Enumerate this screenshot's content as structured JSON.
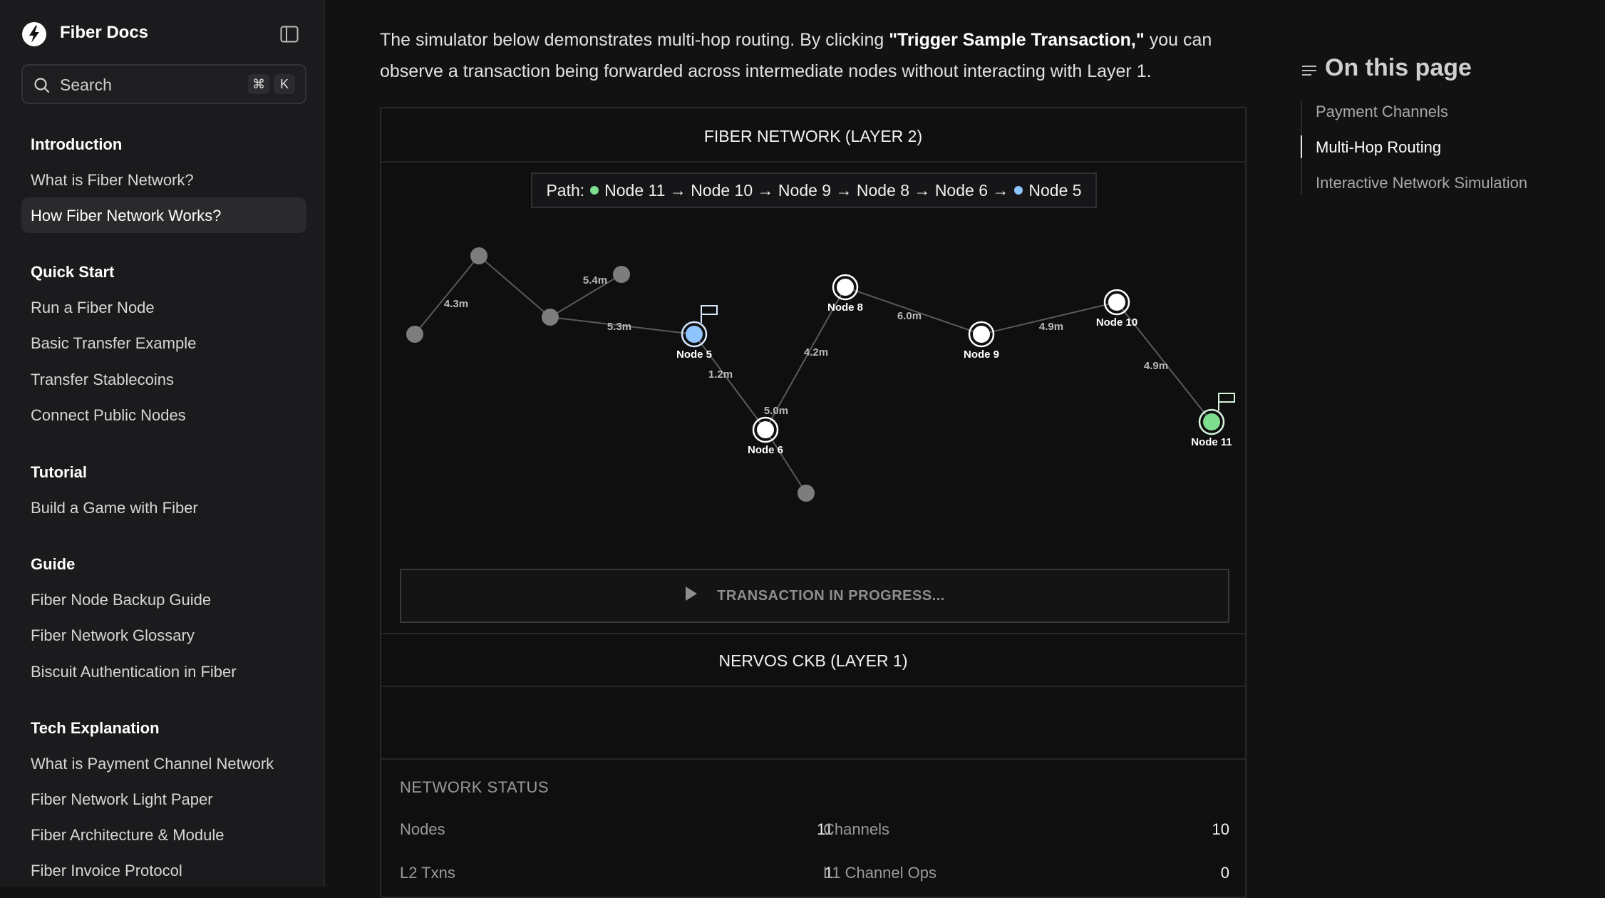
{
  "app": {
    "brand": "Fiber Docs"
  },
  "search": {
    "placeholder": "Search",
    "shortcut_mod": "⌘",
    "shortcut_key": "K"
  },
  "sidebar": {
    "sections": [
      {
        "title": "Introduction",
        "items": [
          "What is Fiber Network?",
          "How Fiber Network Works?"
        ]
      },
      {
        "title": "Quick Start",
        "items": [
          "Run a Fiber Node",
          "Basic Transfer Example",
          "Transfer Stablecoins",
          "Connect Public Nodes"
        ]
      },
      {
        "title": "Tutorial",
        "items": [
          "Build a Game with Fiber"
        ]
      },
      {
        "title": "Guide",
        "items": [
          "Fiber Node Backup Guide",
          "Fiber Network Glossary",
          "Biscuit Authentication in Fiber"
        ]
      },
      {
        "title": "Tech Explanation",
        "items": [
          "What is Payment Channel Network",
          "Fiber Network Light Paper",
          "Fiber Architecture & Module",
          "Fiber Invoice Protocol"
        ]
      }
    ],
    "active_item": "How Fiber Network Works?"
  },
  "main": {
    "intro_pre": "The simulator below demonstrates multi-hop routing. By clicking ",
    "intro_bold": "\"Trigger Sample Transaction,\"",
    "intro_post": " you can observe a transaction being forwarded across intermediate nodes without interacting with Layer 1."
  },
  "simulator": {
    "layer2_title": "FIBER NETWORK (LAYER 2)",
    "path_label": "Path:",
    "path_text": "Node 11 → Node 10 → Node 9 → Node 8 → Node 6 →",
    "path_end": "Node 5",
    "path_start_color": "#7ee08f",
    "path_end_color": "#8ec5ff",
    "nodes": [
      {
        "id": "A",
        "label": ""
      },
      {
        "id": "B",
        "label": ""
      },
      {
        "id": "C",
        "label": ""
      },
      {
        "id": "D",
        "label": ""
      },
      {
        "id": "N5",
        "label": "Node 5",
        "role": "destination"
      },
      {
        "id": "N6",
        "label": "Node 6"
      },
      {
        "id": "E",
        "label": ""
      },
      {
        "id": "N8",
        "label": "Node 8"
      },
      {
        "id": "N9",
        "label": "Node 9"
      },
      {
        "id": "N10",
        "label": "Node 10"
      },
      {
        "id": "N11",
        "label": "Node 11",
        "role": "source"
      }
    ],
    "edges": [
      {
        "from": "A",
        "to": "B",
        "label": "4.3m"
      },
      {
        "from": "B",
        "to": "C",
        "label": ""
      },
      {
        "from": "C",
        "to": "D",
        "label": "5.4m"
      },
      {
        "from": "C",
        "to": "N5",
        "label": "5.3m"
      },
      {
        "from": "N5",
        "to": "N6",
        "label": "1.2m"
      },
      {
        "from": "N6",
        "to": "E",
        "label": "5.0m"
      },
      {
        "from": "N6",
        "to": "N8",
        "label": "4.2m"
      },
      {
        "from": "N8",
        "to": "N9",
        "label": "6.0m"
      },
      {
        "from": "N9",
        "to": "N10",
        "label": "4.9m"
      },
      {
        "from": "N10",
        "to": "N11",
        "label": "4.9m"
      }
    ],
    "button_label": "TRANSACTION IN PROGRESS...",
    "layer1_title": "NERVOS CKB (LAYER 1)",
    "status": {
      "heading": "NETWORK STATUS",
      "nodes_label": "Nodes",
      "nodes_value": "11",
      "channels_label": "Channels",
      "channels_value": "10",
      "l2_label": "L2 Txns",
      "l2_value": "1",
      "l1_label": "L1 Channel Ops",
      "l1_value": "0"
    }
  },
  "toc": {
    "title": "On this page",
    "items": [
      "Payment Channels",
      "Multi-Hop Routing",
      "Interactive Network Simulation"
    ],
    "active_index": 1
  }
}
